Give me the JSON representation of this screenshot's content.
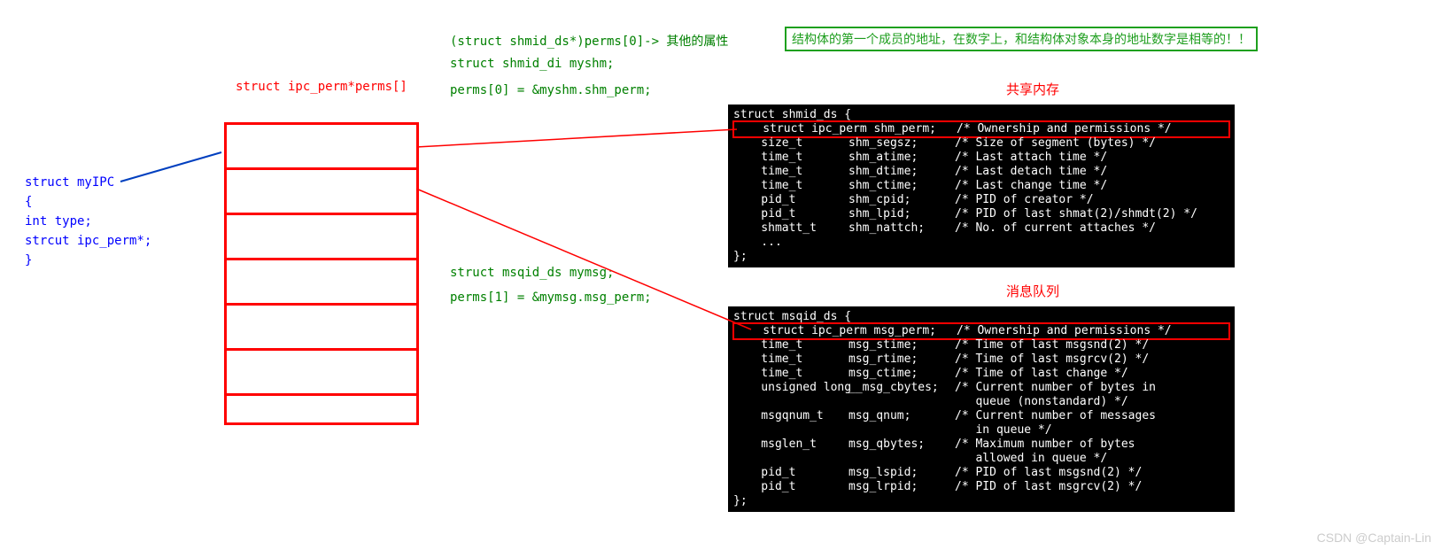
{
  "labels": {
    "perms_array": "struct ipc_perm*perms[]",
    "cast_line": "(struct shmid_ds*)perms[0]-> 其他的属性",
    "shm_decl": "struct shmid_di myshm;",
    "shm_assign": "perms[0] = &myshm.shm_perm;",
    "msg_decl": "struct msqid_ds mymsg;",
    "msg_assign": "perms[1] = &mymsg.msg_perm;",
    "note_box": "结构体的第一个成员的地址，在数字上，和结构体对象本身的地址数字是相等的！！",
    "shared_mem_title": "共享内存",
    "msg_queue_title": "消息队列",
    "watermark": "CSDN @Captain-Lin"
  },
  "myipc": {
    "l1": "struct myIPC",
    "l2": "{",
    "l3": "   int type;",
    "l4": "   strcut ipc_perm*;",
    "l5": "}"
  },
  "shm_block": {
    "head": "struct shmid_ds {",
    "rows": [
      {
        "t": "struct ipc_perm shm_perm;",
        "c": "/* Ownership and permissions */",
        "hl": true,
        "full": true
      },
      {
        "t": "size_t",
        "n": "shm_segsz;",
        "c": "/* Size of segment (bytes) */"
      },
      {
        "t": "time_t",
        "n": "shm_atime;",
        "c": "/* Last attach time */"
      },
      {
        "t": "time_t",
        "n": "shm_dtime;",
        "c": "/* Last detach time */"
      },
      {
        "t": "time_t",
        "n": "shm_ctime;",
        "c": "/* Last change time */"
      },
      {
        "t": "pid_t",
        "n": "shm_cpid;",
        "c": "/* PID of creator */"
      },
      {
        "t": "pid_t",
        "n": "shm_lpid;",
        "c": "/* PID of last shmat(2)/shmdt(2) */"
      },
      {
        "t": "shmatt_t",
        "n": "shm_nattch;",
        "c": "/* No. of current attaches */"
      },
      {
        "t": "...",
        "n": "",
        "c": ""
      }
    ],
    "tail": "};"
  },
  "msg_block": {
    "head": "struct msqid_ds {",
    "rows": [
      {
        "t": "struct ipc_perm msg_perm;",
        "c": "/* Ownership and permissions */",
        "hl": true,
        "full": true
      },
      {
        "t": "time_t",
        "n": "msg_stime;",
        "c": "/* Time of last msgsnd(2) */"
      },
      {
        "t": "time_t",
        "n": "msg_rtime;",
        "c": "/* Time of last msgrcv(2) */"
      },
      {
        "t": "time_t",
        "n": "msg_ctime;",
        "c": "/* Time of last change */"
      },
      {
        "t": "unsigned long",
        "n": "__msg_cbytes;",
        "c": "/* Current number of bytes in"
      },
      {
        "t": "",
        "n": "",
        "c": "   queue (nonstandard) */"
      },
      {
        "t": "msgqnum_t",
        "n": "msg_qnum;",
        "c": "/* Current number of messages"
      },
      {
        "t": "",
        "n": "",
        "c": "   in queue */"
      },
      {
        "t": "msglen_t",
        "n": "msg_qbytes;",
        "c": "/* Maximum number of bytes"
      },
      {
        "t": "",
        "n": "",
        "c": "   allowed in queue */"
      },
      {
        "t": "pid_t",
        "n": "msg_lspid;",
        "c": "/* PID of last msgsnd(2) */"
      },
      {
        "t": "pid_t",
        "n": "msg_lrpid;",
        "c": "/* PID of last msgrcv(2) */"
      }
    ],
    "tail": "};"
  }
}
